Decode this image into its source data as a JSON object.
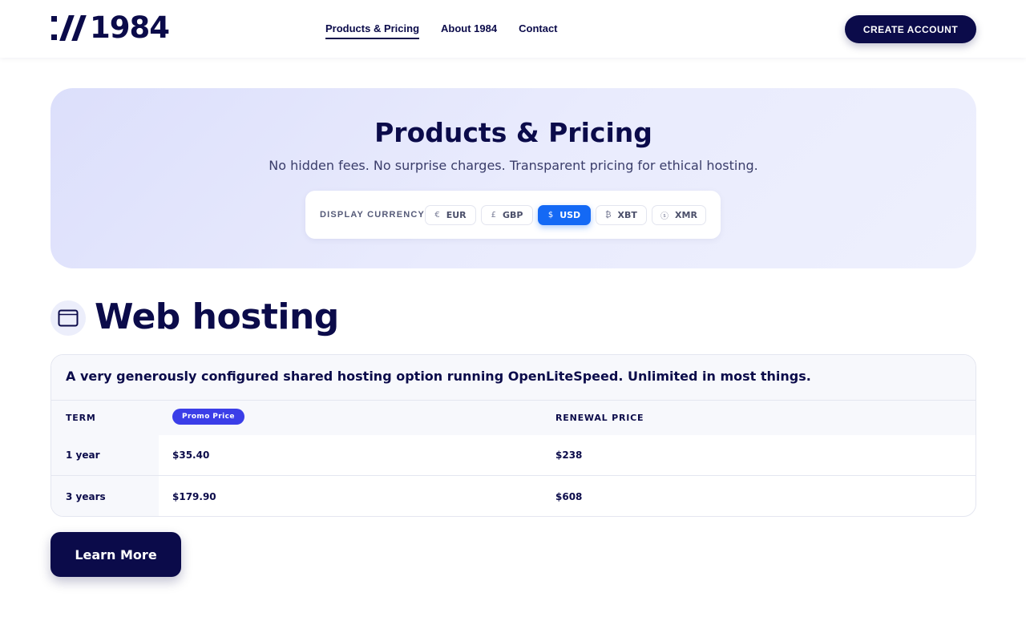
{
  "brand": {
    "logo_text": "1984"
  },
  "nav": {
    "items": [
      {
        "label": "Products & Pricing",
        "active": true
      },
      {
        "label": "About 1984",
        "active": false
      },
      {
        "label": "Contact",
        "active": false
      }
    ],
    "cta_label": "CREATE ACCOUNT"
  },
  "hero": {
    "title": "Products & Pricing",
    "subtitle": "No hidden fees. No surprise charges. Transparent pricing for ethical hosting.",
    "currency_label": "DISPLAY CURRENCY",
    "currencies": [
      {
        "symbol": "€",
        "code": "EUR",
        "selected": false
      },
      {
        "symbol": "£",
        "code": "GBP",
        "selected": false
      },
      {
        "symbol": "$",
        "code": "USD",
        "selected": true
      },
      {
        "symbol": "₿",
        "code": "XBT",
        "selected": false
      },
      {
        "symbol": "ⓢ",
        "code": "XMR",
        "selected": false
      }
    ]
  },
  "section": {
    "icon": "browser-window-icon",
    "title": "Web hosting",
    "description": "A very generously configured shared hosting option running OpenLiteSpeed. Unlimited in most things.",
    "table": {
      "headers": {
        "term": "TERM",
        "promo_badge": "Promo Price",
        "renewal": "RENEWAL PRICE"
      },
      "rows": [
        {
          "term": "1 year",
          "promo": "$35.40",
          "renewal": "$238"
        },
        {
          "term": "3 years",
          "promo": "$179.90",
          "renewal": "$608"
        }
      ]
    },
    "learn_more_label": "Learn More"
  },
  "colors": {
    "navy": "#0b0b4a",
    "accent_blue": "#1469f5",
    "badge_purple": "#3b3ee8"
  }
}
